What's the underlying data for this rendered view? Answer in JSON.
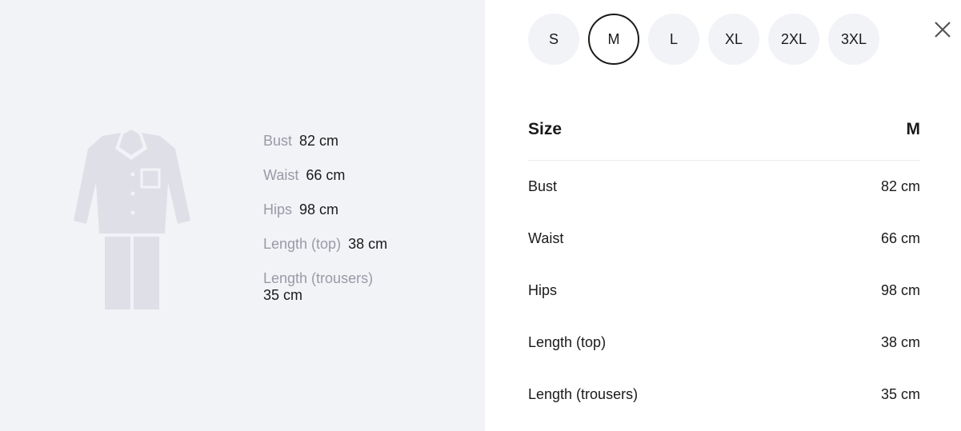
{
  "figure": {
    "measurements": [
      {
        "label": "Bust",
        "value": "82 cm"
      },
      {
        "label": "Waist",
        "value": "66 cm"
      },
      {
        "label": "Hips",
        "value": "98 cm"
      },
      {
        "label": "Length (top)",
        "value": "38 cm"
      },
      {
        "label": "Length (trousers)",
        "value": "35 cm"
      }
    ]
  },
  "sizes": [
    "S",
    "M",
    "L",
    "XL",
    "2XL",
    "3XL"
  ],
  "selected_size": "M",
  "table": {
    "header_label": "Size",
    "header_value": "M",
    "rows": [
      {
        "label": "Bust",
        "value": "82 cm"
      },
      {
        "label": "Waist",
        "value": "66 cm"
      },
      {
        "label": "Hips",
        "value": "98 cm"
      },
      {
        "label": "Length (top)",
        "value": "38 cm"
      },
      {
        "label": "Length (trousers)",
        "value": "35 cm"
      }
    ]
  },
  "colors": {
    "panel_bg": "#f2f3f7",
    "illustration": "#dfe0e7",
    "muted_text": "#9a9aa6",
    "text": "#1a1a1a"
  },
  "icons": {
    "close": "close-icon",
    "garment": "pajama-illustration"
  }
}
